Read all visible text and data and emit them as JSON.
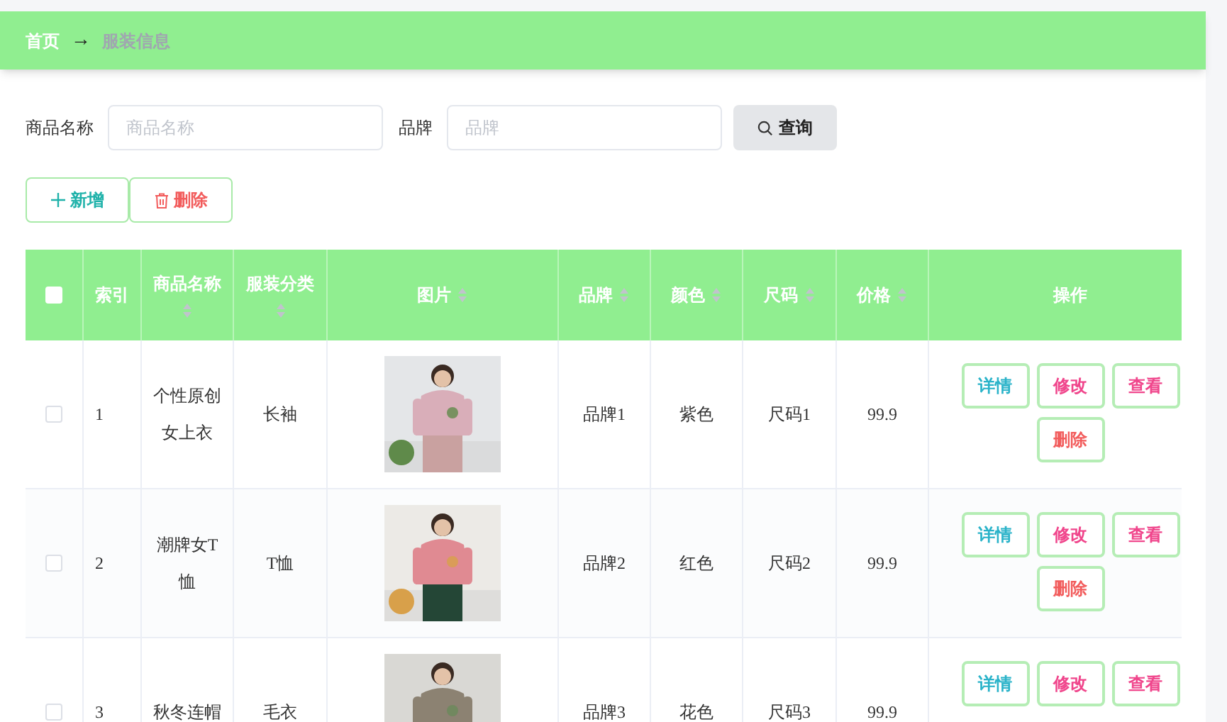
{
  "breadcrumb": {
    "items": [
      {
        "label": "首页",
        "current": false
      },
      {
        "label": "服装信息",
        "current": true
      }
    ],
    "separator": "→"
  },
  "filters": [
    {
      "label": "商品名称",
      "placeholder": "商品名称"
    },
    {
      "label": "品牌",
      "placeholder": "品牌"
    }
  ],
  "search_button": "查询",
  "toolbar": [
    {
      "kind": "add",
      "label": "新增"
    },
    {
      "kind": "delete",
      "label": "删除"
    }
  ],
  "table": {
    "select_all": {
      "checked": false
    },
    "columns": [
      {
        "label": "索引",
        "sortable": false
      },
      {
        "label": "商品名称",
        "sortable": true
      },
      {
        "label": "服装分类",
        "sortable": true
      },
      {
        "label": "图片",
        "sortable": true
      },
      {
        "label": "品牌",
        "sortable": true
      },
      {
        "label": "颜色",
        "sortable": true
      },
      {
        "label": "尺码",
        "sortable": true
      },
      {
        "label": "价格",
        "sortable": true
      },
      {
        "label": "操作",
        "sortable": false
      }
    ],
    "rows": [
      {
        "selected": false,
        "index": "1",
        "name": "个性原创女上衣",
        "category": "长袖",
        "image": {
          "kind": "picture"
        },
        "brand": "品牌1",
        "color_label": "紫色",
        "size": "尺码1",
        "price": "99.9",
        "actions": [
          {
            "kind": "detail",
            "label": "详情"
          },
          {
            "kind": "edit",
            "label": "修改"
          },
          {
            "kind": "view",
            "label": "查看"
          },
          {
            "kind": "delete",
            "label": "删除"
          }
        ]
      },
      {
        "selected": false,
        "index": "2",
        "name": "潮牌女T恤",
        "category": "T恤",
        "image": {
          "kind": "picture"
        },
        "brand": "品牌2",
        "color_label": "红色",
        "size": "尺码2",
        "price": "99.9",
        "actions": [
          {
            "kind": "detail",
            "label": "详情"
          },
          {
            "kind": "edit",
            "label": "修改"
          },
          {
            "kind": "view",
            "label": "查看"
          },
          {
            "kind": "delete",
            "label": "删除"
          }
        ]
      },
      {
        "selected": false,
        "index": "3",
        "name": "秋冬连帽",
        "category": "毛衣",
        "image": {
          "kind": "picture"
        },
        "brand": "品牌3",
        "color_label": "花色",
        "size": "尺码3",
        "price": "99.9",
        "actions": [
          {
            "kind": "detail",
            "label": "详情"
          },
          {
            "kind": "edit",
            "label": "修改"
          },
          {
            "kind": "view",
            "label": "查看"
          }
        ]
      }
    ]
  }
}
